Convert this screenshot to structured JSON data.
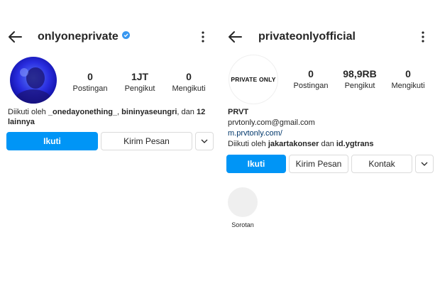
{
  "left": {
    "username": "onlyoneprivate",
    "stats": [
      {
        "value": "0",
        "label": "Postingan"
      },
      {
        "value": "1JT",
        "label": "Pengikut"
      },
      {
        "value": "0",
        "label": "Mengikuti"
      }
    ],
    "followed_prefix": "Diikuti oleh ",
    "followed_user1": "_onedayonething_",
    "followed_sep1": ", ",
    "followed_user2": "bininyaseungri",
    "followed_sep2": ", dan ",
    "followed_count": "12",
    "followed_more": "lainnya",
    "follow_button": "Ikuti",
    "message_button": "Kirim Pesan"
  },
  "right": {
    "username": "privateonlyofficial",
    "avatar_text": "PRIVATE ONLY",
    "stats": [
      {
        "value": "0",
        "label": "Postingan"
      },
      {
        "value": "98,9RB",
        "label": "Pengikut"
      },
      {
        "value": "0",
        "label": "Mengikuti"
      }
    ],
    "bio_name": "PRVT",
    "bio_email": "prvtonly.com@gmail.com",
    "bio_link": "m.prvtonly.com/",
    "followed_prefix": "Diikuti oleh ",
    "followed_user1": "jakartakonser",
    "followed_sep": " dan ",
    "followed_user2": "id.ygtrans",
    "follow_button": "Ikuti",
    "message_button": "Kirim Pesan",
    "contact_button": "Kontak",
    "highlight_label": "Sorotan"
  },
  "colors": {
    "accent": "#0095f6",
    "verified": "#3897f0",
    "text": "#262626",
    "border": "#dbdbdb"
  },
  "icons": [
    "arrow-back-icon",
    "verified-badge-icon",
    "more-vertical-icon",
    "chevron-down-icon"
  ]
}
